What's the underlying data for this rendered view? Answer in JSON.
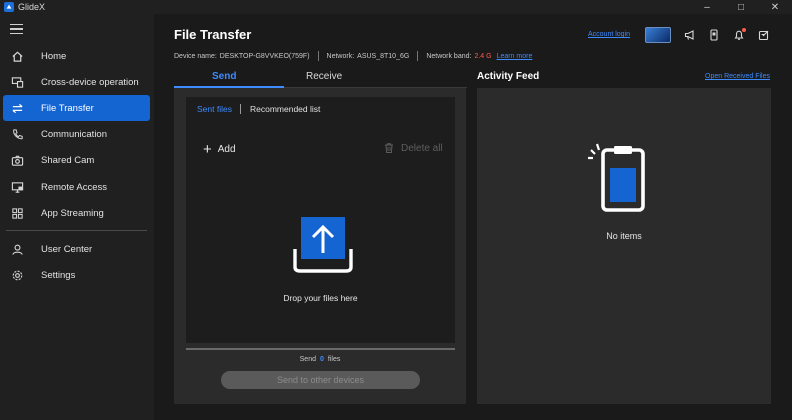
{
  "app": {
    "title": "GlideX"
  },
  "window_controls": {
    "minimize": "–",
    "maximize": "□",
    "close": "✕"
  },
  "sidebar": {
    "items": [
      {
        "label": "Home",
        "icon": "home-icon"
      },
      {
        "label": "Cross-device operation",
        "icon": "cross-device-icon"
      },
      {
        "label": "File Transfer",
        "icon": "file-transfer-icon",
        "active": true
      },
      {
        "label": "Communication",
        "icon": "phone-icon"
      },
      {
        "label": "Shared Cam",
        "icon": "camera-icon"
      },
      {
        "label": "Remote Access",
        "icon": "remote-access-icon"
      },
      {
        "label": "App Streaming",
        "icon": "app-grid-icon"
      },
      {
        "label": "User Center",
        "icon": "user-icon"
      },
      {
        "label": "Settings",
        "icon": "gear-icon"
      }
    ]
  },
  "header": {
    "title": "File Transfer",
    "device_name_label": "Device name:",
    "device_name": "DESKTOP-G8VVKEO(759F)",
    "network_label": "Network:",
    "network": "ASUS_8T10_6G",
    "network_band_label": "Network band:",
    "network_band": "2.4 G",
    "learn_more": "Learn more",
    "account_login": "Account login"
  },
  "tabs": {
    "send": "Send",
    "receive": "Receive"
  },
  "send_panel": {
    "subtab_sent": "Sent files",
    "subtab_recommended": "Recommended list",
    "add_label": "Add",
    "delete_all_label": "Delete all",
    "drop_text": "Drop your files here",
    "send_prefix": "Send",
    "send_count": "0",
    "send_suffix": "files",
    "send_button": "Send to other devices"
  },
  "activity_feed": {
    "title": "Activity Feed",
    "open_received": "Open Received Files",
    "empty_text": "No items"
  },
  "colors": {
    "accent": "#1464d2",
    "link": "#3d8bff",
    "warning": "#ff5a4d",
    "panel": "#2b2b2b"
  }
}
